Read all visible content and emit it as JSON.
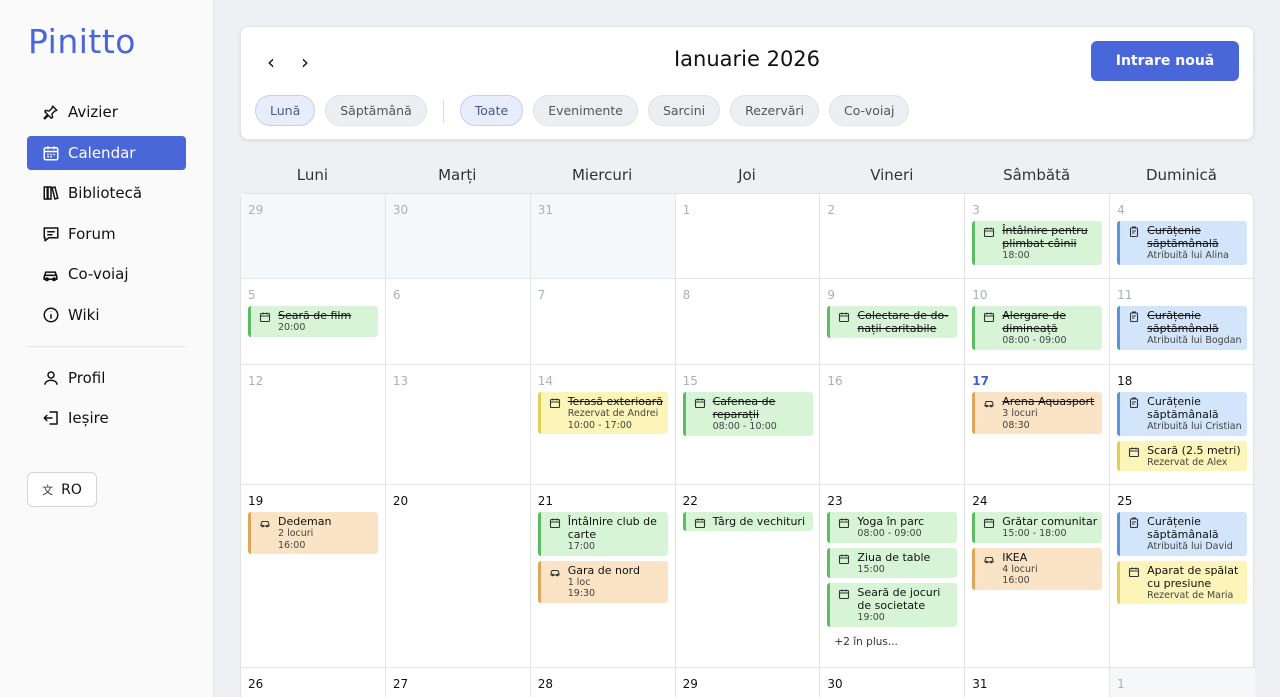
{
  "app": {
    "logo": "Pinitto"
  },
  "sidebar": {
    "items": [
      {
        "label": "Avizier",
        "icon": "pin-icon",
        "active": false
      },
      {
        "label": "Calendar",
        "icon": "calendar-icon",
        "active": true
      },
      {
        "label": "Bibliotecă",
        "icon": "library-icon",
        "active": false
      },
      {
        "label": "Forum",
        "icon": "chat-icon",
        "active": false
      },
      {
        "label": "Co-voiaj",
        "icon": "car-icon",
        "active": false
      },
      {
        "label": "Wiki",
        "icon": "info-icon",
        "active": false
      }
    ],
    "bottom_items": [
      {
        "label": "Profil",
        "icon": "user-icon"
      },
      {
        "label": "Ieșire",
        "icon": "logout-icon"
      }
    ],
    "language": "RO"
  },
  "header": {
    "month_title": "Ianuarie 2026",
    "new_entry": "Intrare nouă",
    "view_chips": [
      {
        "label": "Lună",
        "selected": true
      },
      {
        "label": "Săptămână",
        "selected": false
      }
    ],
    "filter_chips": [
      {
        "label": "Toate",
        "selected": true
      },
      {
        "label": "Evenimente",
        "selected": false
      },
      {
        "label": "Sarcini",
        "selected": false
      },
      {
        "label": "Rezervări",
        "selected": false
      },
      {
        "label": "Co-voiaj",
        "selected": false
      }
    ]
  },
  "calendar": {
    "weekdays": [
      "Luni",
      "Marți",
      "Miercuri",
      "Joi",
      "Vineri",
      "Sâmbătă",
      "Duminică"
    ],
    "weeks": [
      {
        "days": [
          {
            "num": "29",
            "muted": true,
            "outside": true,
            "events": []
          },
          {
            "num": "30",
            "muted": true,
            "outside": true,
            "events": []
          },
          {
            "num": "31",
            "muted": true,
            "outside": true,
            "events": []
          },
          {
            "num": "1",
            "muted": true,
            "events": []
          },
          {
            "num": "2",
            "muted": true,
            "events": []
          },
          {
            "num": "3",
            "muted": true,
            "events": [
              {
                "title": "Întâlnire pentru plimbat câinii",
                "sub": [
                  "18:00"
                ],
                "color": "green",
                "icon": "calendar-icon",
                "done": true
              }
            ]
          },
          {
            "num": "4",
            "muted": true,
            "events": [
              {
                "title": "Curățenie săptămânală",
                "sub": [
                  "Atribuită lui Alina"
                ],
                "color": "blue",
                "icon": "task-icon",
                "done": true
              }
            ]
          }
        ]
      },
      {
        "days": [
          {
            "num": "5",
            "muted": true,
            "events": [
              {
                "title": "Seară de film",
                "sub": [
                  "20:00"
                ],
                "color": "green",
                "icon": "calendar-icon",
                "done": true
              }
            ]
          },
          {
            "num": "6",
            "muted": true,
            "events": []
          },
          {
            "num": "7",
            "muted": true,
            "events": []
          },
          {
            "num": "8",
            "muted": true,
            "events": []
          },
          {
            "num": "9",
            "muted": true,
            "events": [
              {
                "title": "Colectare de do-nații caritabile",
                "sub": [],
                "color": "green",
                "icon": "calendar-icon",
                "done": true
              }
            ]
          },
          {
            "num": "10",
            "muted": true,
            "events": [
              {
                "title": "Alergare de dimineață",
                "sub": [
                  "08:00 - 09:00"
                ],
                "color": "green",
                "icon": "calendar-icon",
                "done": true
              }
            ]
          },
          {
            "num": "11",
            "muted": true,
            "events": [
              {
                "title": "Curățenie săptămânală",
                "sub": [
                  "Atribuită lui Bogdan"
                ],
                "color": "blue",
                "icon": "task-icon",
                "done": true
              }
            ]
          }
        ]
      },
      {
        "days": [
          {
            "num": "12",
            "muted": true,
            "events": []
          },
          {
            "num": "13",
            "muted": true,
            "events": []
          },
          {
            "num": "14",
            "muted": true,
            "events": [
              {
                "title": "Terasă exterioară",
                "sub": [
                  "Rezervat de Andrei",
                  "10:00 - 17:00"
                ],
                "color": "yellow",
                "icon": "calendar-icon",
                "done": true
              }
            ]
          },
          {
            "num": "15",
            "muted": true,
            "events": [
              {
                "title": "Cafenea de reparații",
                "sub": [
                  "08:00 - 10:00"
                ],
                "color": "green",
                "icon": "calendar-icon",
                "done": true
              }
            ]
          },
          {
            "num": "16",
            "muted": true,
            "events": []
          },
          {
            "num": "17",
            "today": true,
            "events": [
              {
                "title": "Arena Aquasport",
                "sub": [
                  "3 locuri",
                  "08:30"
                ],
                "color": "orange",
                "icon": "car-icon",
                "done": true
              }
            ]
          },
          {
            "num": "18",
            "events": [
              {
                "title": "Curățenie săptămânală",
                "sub": [
                  "Atribuită lui Cristian"
                ],
                "color": "blue",
                "icon": "task-icon",
                "done": false
              },
              {
                "title": "Scară (2.5 metri)",
                "sub": [
                  "Rezervat de Alex"
                ],
                "color": "yellow",
                "icon": "calendar-icon",
                "done": false
              }
            ]
          }
        ]
      },
      {
        "days": [
          {
            "num": "19",
            "events": [
              {
                "title": "Dedeman",
                "sub": [
                  "2 locuri",
                  "16:00"
                ],
                "color": "orange",
                "icon": "car-icon",
                "done": false
              }
            ]
          },
          {
            "num": "20",
            "events": []
          },
          {
            "num": "21",
            "events": [
              {
                "title": "Întâlnire club de carte",
                "sub": [
                  "17:00"
                ],
                "color": "green",
                "icon": "calendar-icon",
                "done": false
              },
              {
                "title": "Gara de nord",
                "sub": [
                  "1 loc",
                  "19:30"
                ],
                "color": "orange",
                "icon": "car-icon",
                "done": false
              }
            ]
          },
          {
            "num": "22",
            "events": [
              {
                "title": "Târg de vechituri",
                "sub": [],
                "color": "green",
                "icon": "calendar-icon",
                "done": false
              }
            ]
          },
          {
            "num": "23",
            "events": [
              {
                "title": "Yoga în parc",
                "sub": [
                  "08:00 - 09:00"
                ],
                "color": "green",
                "icon": "calendar-icon",
                "done": false
              },
              {
                "title": "Ziua de table",
                "sub": [
                  "15:00"
                ],
                "color": "green",
                "icon": "calendar-icon",
                "done": false
              },
              {
                "title": "Seară de jocuri de societate",
                "sub": [
                  "19:00"
                ],
                "color": "green",
                "icon": "calendar-icon",
                "done": false
              }
            ],
            "more": "+2 în plus..."
          },
          {
            "num": "24",
            "events": [
              {
                "title": "Grătar comunitar",
                "sub": [
                  "15:00 - 18:00"
                ],
                "color": "green",
                "icon": "calendar-icon",
                "done": false
              },
              {
                "title": "IKEA",
                "sub": [
                  "4 locuri",
                  "16:00"
                ],
                "color": "orange",
                "icon": "car-icon",
                "done": false
              }
            ]
          },
          {
            "num": "25",
            "events": [
              {
                "title": "Curățenie săptămânală",
                "sub": [
                  "Atribuită lui David"
                ],
                "color": "blue",
                "icon": "task-icon",
                "done": false
              },
              {
                "title": "Aparat de spălat cu presiune",
                "sub": [
                  "Rezervat de Maria"
                ],
                "color": "yellow",
                "icon": "calendar-icon",
                "done": false
              }
            ]
          }
        ]
      },
      {
        "days": [
          {
            "num": "26",
            "events": []
          },
          {
            "num": "27",
            "events": []
          },
          {
            "num": "28",
            "events": []
          },
          {
            "num": "29",
            "events": []
          },
          {
            "num": "30",
            "events": []
          },
          {
            "num": "31",
            "events": []
          },
          {
            "num": "1",
            "muted": true,
            "outside": true,
            "events": []
          }
        ]
      }
    ]
  },
  "colors": {
    "accent": "#4967d9",
    "event_green": "#d7f5d6",
    "task_blue": "#d2e5fb",
    "ride_orange": "#fbe3c6",
    "booking_yellow": "#fcf4b8"
  }
}
